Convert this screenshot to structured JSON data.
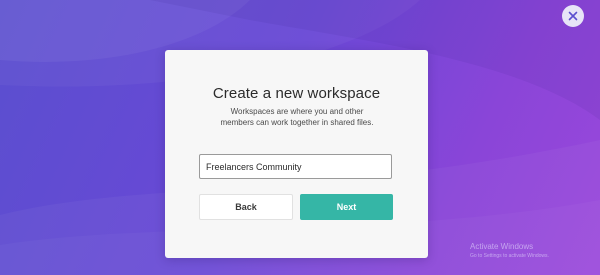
{
  "dialog": {
    "title": "Create a new workspace",
    "description": "Workspaces are where you and other members can work together in shared files.",
    "workspace_name_value": "Freelancers Community",
    "back_label": "Back",
    "next_label": "Next"
  },
  "close_button": {
    "icon": "close-icon"
  },
  "watermark": {
    "title": "Activate Windows",
    "subtitle": "Go to Settings to activate Windows."
  },
  "colors": {
    "background_start": "#5a4fcf",
    "background_end": "#9a48db",
    "primary_button": "#35b6a6",
    "modal_background": "#f7f7f7"
  }
}
